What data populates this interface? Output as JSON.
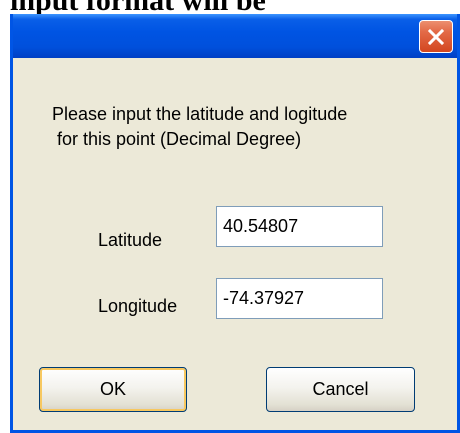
{
  "background": {
    "heading_fragment": "input format will be"
  },
  "dialog": {
    "close_icon": "close-x-icon",
    "prompt_line1": "Please input the latitude and logitude",
    "prompt_line2": " for this point (Decimal Degree)",
    "latitude": {
      "label": "Latitude",
      "value": "40.54807"
    },
    "longitude": {
      "label": "Longitude",
      "value": "-74.37927"
    },
    "ok_label": "OK",
    "cancel_label": "Cancel"
  },
  "colors": {
    "titlebar": "#0054e3",
    "close_button": "#e36a47",
    "dialog_face": "#ece9d8"
  }
}
